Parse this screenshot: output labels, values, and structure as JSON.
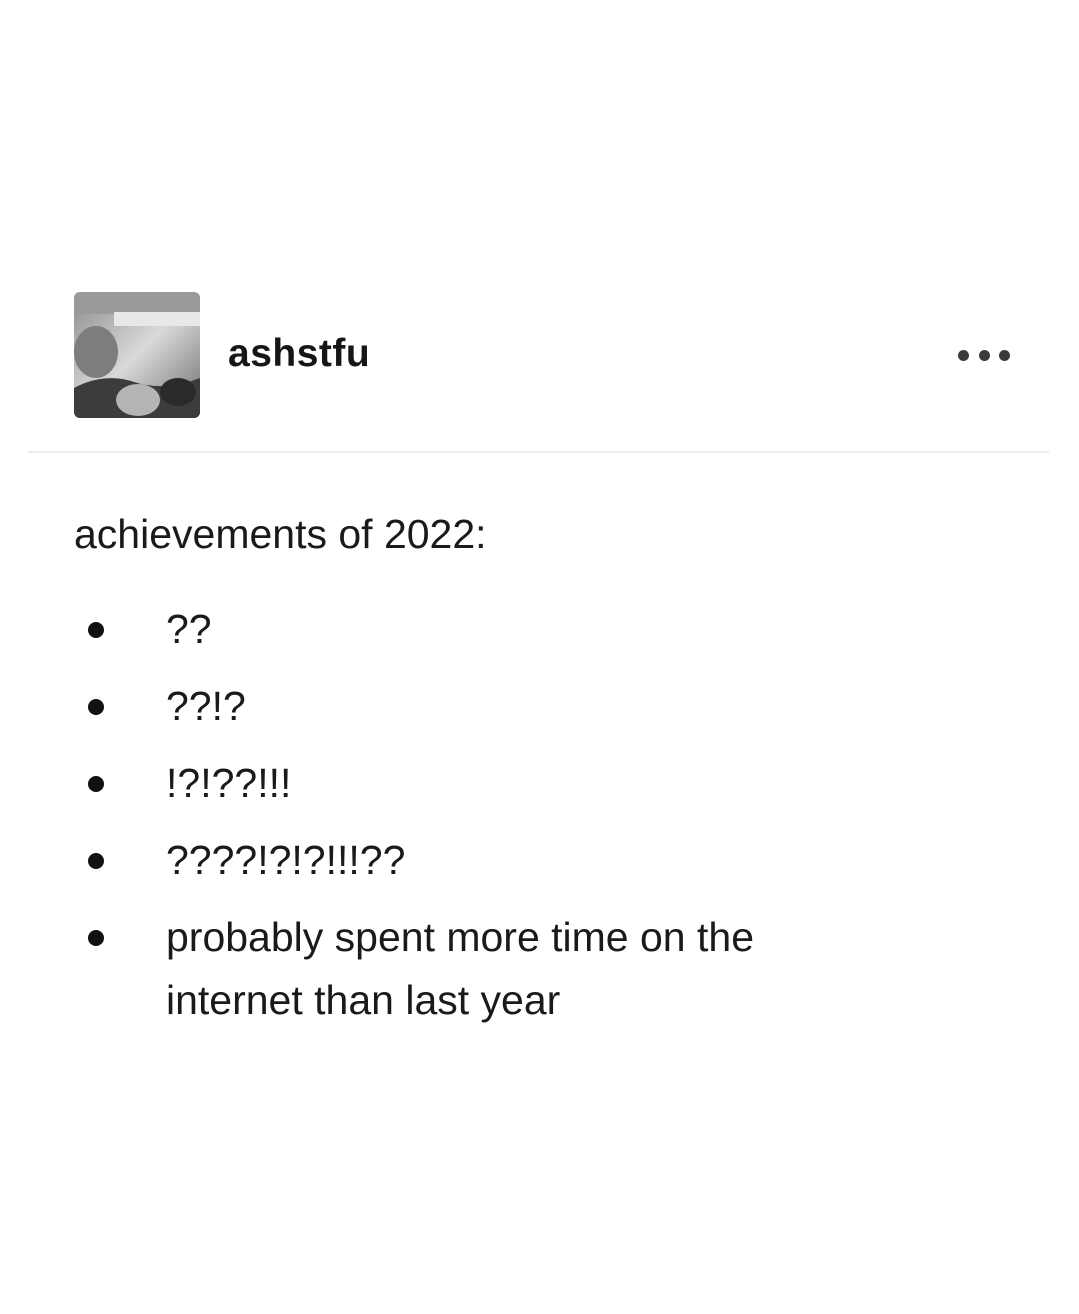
{
  "post": {
    "username": "ashstfu",
    "heading": "achievements of 2022:",
    "list_items": [
      "??",
      "??!?",
      "!?!??!!!",
      "????!?!?!!!??",
      "probably spent more time on the internet than last year"
    ]
  },
  "icons": {
    "more": "more-horizontal-icon"
  },
  "colors": {
    "background": "#ffffff",
    "text": "#1a1a1a",
    "divider": "#ececec"
  }
}
